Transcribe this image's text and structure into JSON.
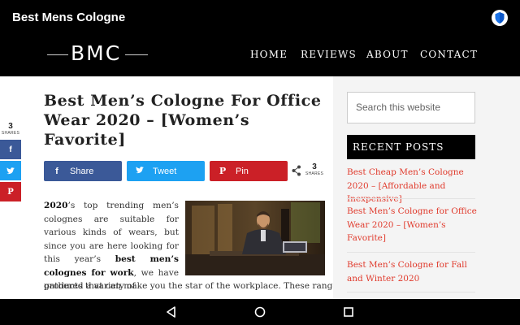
{
  "app": {
    "title": "Best Mens Cologne",
    "shield_icon": "shield-icon"
  },
  "site": {
    "logo": "BMC",
    "nav": [
      "HOME",
      "REVIEWS",
      "ABOUT",
      "CONTACT"
    ]
  },
  "share_rail": {
    "count": "3",
    "label": "SHARES",
    "icons": [
      "f",
      "❥"
    ]
  },
  "post": {
    "title": "Best Men’s Cologne For Office Wear 2020 – [Women’s Favorite]",
    "share_buttons": [
      {
        "label": "Share",
        "icon": "f"
      },
      {
        "label": "Tweet",
        "icon": "❥"
      },
      {
        "label": "Pin",
        "icon": "P"
      }
    ],
    "share_total": "3",
    "share_total_label": "SHARES",
    "body": {
      "p1_bold_year": "2020",
      "p1_text_a": "’s top trending men’s colognes are suitable for various kinds of wears, but since you are here looking for this year’s",
      "p1_bold_phrase": "best men’s colognes for work",
      "p1_text_b": ", we have gathered a variety of",
      "line_wide": "products that can make you the star of the workplace. These range"
    }
  },
  "sidebar": {
    "search_placeholder": "Search this website",
    "recent_heading": "RECENT POSTS",
    "recent_posts": [
      "Best Cheap Men’s Cologne 2020 – [Affordable and Inexpensive]",
      "Best Men’s Cologne for Office Wear 2020 – [Women’s Favorite]",
      "Best Men’s Cologne for Fall and Winter 2020"
    ]
  },
  "colors": {
    "facebook": "#3b5998",
    "twitter": "#1da1f2",
    "pinterest": "#cb2027",
    "link": "#e03a2c",
    "bar": "#000000"
  }
}
